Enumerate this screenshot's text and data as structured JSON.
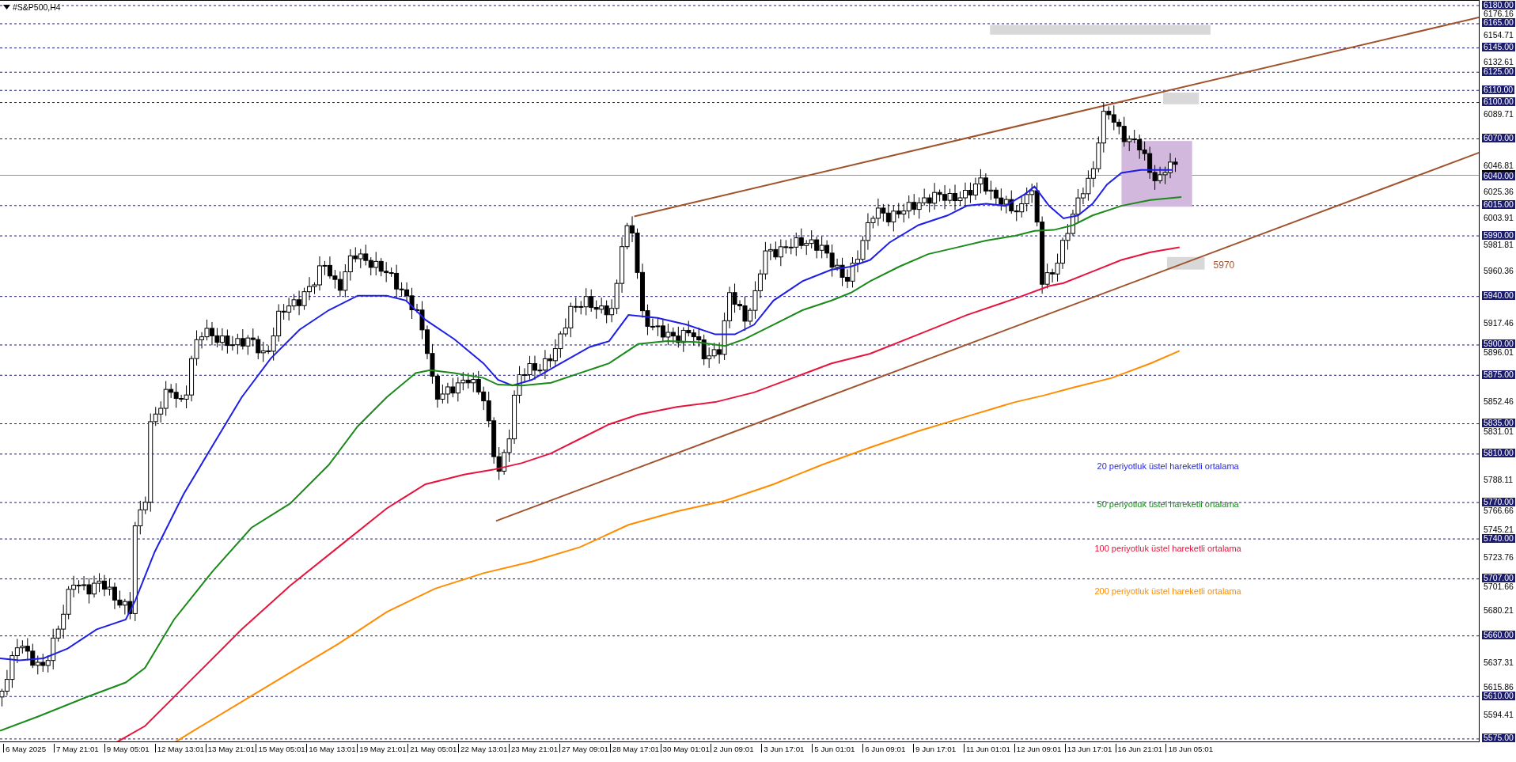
{
  "chart": {
    "title": "#S&P500,H4",
    "price_axis": [
      {
        "text": "6180.00",
        "kind": "level"
      },
      {
        "text": "6176.16",
        "kind": "tick"
      },
      {
        "text": "6165.00",
        "kind": "level"
      },
      {
        "text": "6154.71",
        "kind": "tick"
      },
      {
        "text": "6145.00",
        "kind": "level"
      },
      {
        "text": "6132.61",
        "kind": "tick"
      },
      {
        "text": "6125.00",
        "kind": "level"
      },
      {
        "text": "6110.00",
        "kind": "level"
      },
      {
        "text": "6100.00",
        "kind": "level"
      },
      {
        "text": "6089.71",
        "kind": "tick"
      },
      {
        "text": "6070.00",
        "kind": "level"
      },
      {
        "text": "6046.81",
        "kind": "tick"
      },
      {
        "text": "6040.00",
        "kind": "current"
      },
      {
        "text": "6025.36",
        "kind": "tick"
      },
      {
        "text": "6015.00",
        "kind": "level"
      },
      {
        "text": "6003.91",
        "kind": "tick"
      },
      {
        "text": "5990.00",
        "kind": "level"
      },
      {
        "text": "5981.81",
        "kind": "tick"
      },
      {
        "text": "5960.36",
        "kind": "tick"
      },
      {
        "text": "5940.00",
        "kind": "level"
      },
      {
        "text": "5917.46",
        "kind": "tick"
      },
      {
        "text": "5900.00",
        "kind": "level"
      },
      {
        "text": "5896.01",
        "kind": "tick"
      },
      {
        "text": "5875.00",
        "kind": "level"
      },
      {
        "text": "5852.46",
        "kind": "tick"
      },
      {
        "text": "5835.00",
        "kind": "level"
      },
      {
        "text": "5831.01",
        "kind": "tick"
      },
      {
        "text": "5810.00",
        "kind": "level"
      },
      {
        "text": "5788.11",
        "kind": "tick"
      },
      {
        "text": "5770.00",
        "kind": "level"
      },
      {
        "text": "5766.66",
        "kind": "tick"
      },
      {
        "text": "5745.21",
        "kind": "tick"
      },
      {
        "text": "5740.00",
        "kind": "level"
      },
      {
        "text": "5723.76",
        "kind": "tick"
      },
      {
        "text": "5707.00",
        "kind": "level"
      },
      {
        "text": "5701.66",
        "kind": "tick"
      },
      {
        "text": "5680.21",
        "kind": "tick"
      },
      {
        "text": "5660.00",
        "kind": "level"
      },
      {
        "text": "5637.31",
        "kind": "tick"
      },
      {
        "text": "5615.86",
        "kind": "tick"
      },
      {
        "text": "5610.00",
        "kind": "level"
      },
      {
        "text": "5594.41",
        "kind": "tick"
      },
      {
        "text": "5575.00",
        "kind": "level"
      }
    ],
    "time_axis": [
      "6 May 2025",
      "7 May 21:01",
      "9 May 05:01",
      "12 May 13:01",
      "13 May 21:01",
      "15 May 05:01",
      "16 May 13:01",
      "19 May 21:01",
      "21 May 05:01",
      "22 May 13:01",
      "23 May 21:01",
      "27 May 09:01",
      "28 May 17:01",
      "30 May 01:01",
      "2 Jun 09:01",
      "3 Jun 17:01",
      "5 Jun 01:01",
      "6 Jun 09:01",
      "9 Jun 17:01",
      "11 Jun 01:01",
      "12 Jun 09:01",
      "13 Jun 17:01",
      "16 Jun 21:01",
      "18 Jun 05:01"
    ],
    "price_label": "5970",
    "legend": [
      {
        "text": "20 periyotluk üstel hareketli ortalama",
        "color": "#1e1ee6"
      },
      {
        "text": "50 periyotluk üstel hareketli ortalama",
        "color": "#1a8a1a"
      },
      {
        "text": "100 periyotluk üstel hareketli ortalama",
        "color": "#e6143c"
      },
      {
        "text": "200 periyotluk üstel hareketli ortalama",
        "color": "#ff8c00"
      }
    ]
  }
}
